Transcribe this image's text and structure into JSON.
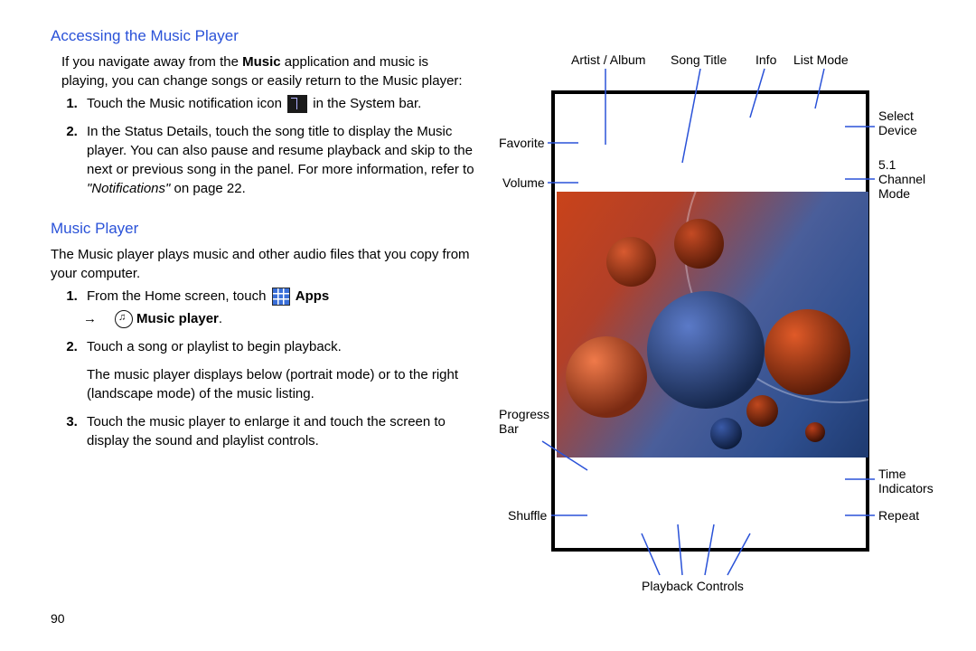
{
  "headings": {
    "accessing": "Accessing the Music Player",
    "music_player": "Music Player"
  },
  "text": {
    "intro1a": "If you navigate away from the ",
    "intro1_app": "Music",
    "intro1b": " application and music is playing, you can change songs or easily return to the Music player:",
    "step1a": "Touch the Music notification icon ",
    "step1b": " in the System bar.",
    "step2a": "In the Status Details, touch the song title to display the Music player. You can also pause and resume playback and skip to the next or previous song in the panel. For more information, refer to ",
    "step2_ref": "\"Notifications\"",
    "step2b": " on page 22.",
    "mp_intro": "The Music player plays music and other audio files that you copy from your computer.",
    "mp1a": "From the Home screen, touch ",
    "mp1_apps": "Apps",
    "mp1_arrow": " ",
    "mp1_music": "Music player",
    "mp1c": ".",
    "mp2": "Touch a song or playlist to begin playback.",
    "mp2_sub": "The music player displays below (portrait mode) or to the right (landscape mode) of the music listing.",
    "mp3": "Touch the music player to enlarge it and touch the screen to display the sound and playlist controls."
  },
  "page_number": "90",
  "diagram_labels": {
    "artist_album": "Artist / Album",
    "song_title": "Song Title",
    "info": "Info",
    "list_mode": "List Mode",
    "favorite": "Favorite",
    "volume": "Volume",
    "select_device": "Select Device",
    "channel_mode": "5.1 Channel Mode",
    "progress_bar": "Progress Bar",
    "time_indicators": "Time Indicators",
    "shuffle": "Shuffle",
    "repeat": "Repeat",
    "playback": "Playback Controls"
  }
}
